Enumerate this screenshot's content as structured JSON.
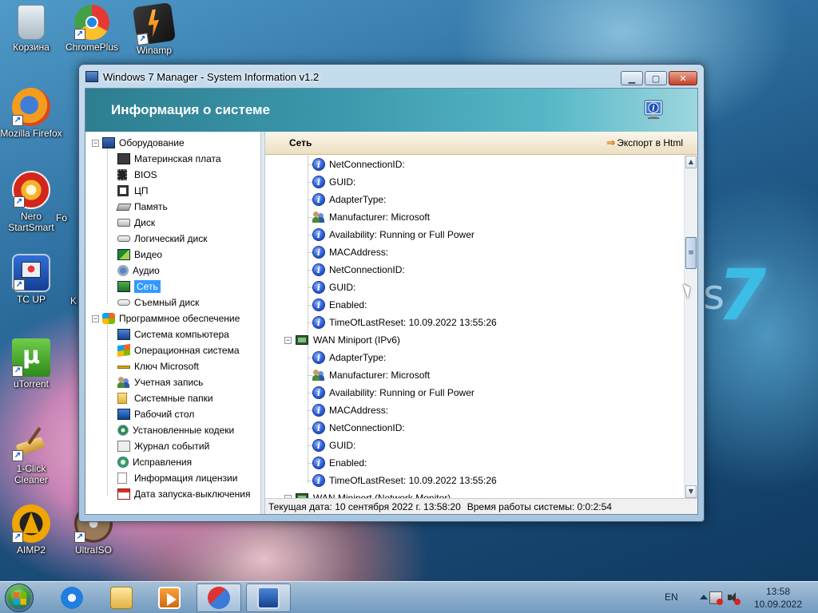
{
  "desktop": {
    "icons": [
      {
        "id": "recycle",
        "label": "Корзина"
      },
      {
        "id": "chromeplus",
        "label": "ChromePlus"
      },
      {
        "id": "winamp",
        "label": "Winamp"
      },
      {
        "id": "firefox",
        "label": "Mozilla Firefox"
      },
      {
        "id": "nero",
        "label": "Nero StartSmart"
      },
      {
        "id": "tcup",
        "label": "TC UP"
      },
      {
        "id": "utorrent",
        "label": "uTorrent"
      },
      {
        "id": "oneclick",
        "label": "1-Click Cleaner"
      },
      {
        "id": "aimp",
        "label": "AIMP2"
      },
      {
        "id": "ultraiso",
        "label": "UltraISO"
      }
    ],
    "partial_labels": [
      "Fo",
      "K"
    ],
    "logo_text": "7",
    "logo_partial": "s"
  },
  "window": {
    "title": "Windows 7 Manager - System Information v1.2",
    "header_title": "Информация о системе",
    "controls": {
      "minimize": "▁",
      "maximize": "▢",
      "close": "✕"
    }
  },
  "tree": {
    "hardware": {
      "label": "Оборудование",
      "items": [
        {
          "label": "Материнская плата",
          "icon": "motherboard-icon"
        },
        {
          "label": "BIOS",
          "icon": "bios-chip-icon"
        },
        {
          "label": "ЦП",
          "icon": "cpu-icon"
        },
        {
          "label": "Память",
          "icon": "memory-icon"
        },
        {
          "label": "Диск",
          "icon": "disk-icon"
        },
        {
          "label": "Логический диск",
          "icon": "logical-disk-icon"
        },
        {
          "label": "Видео",
          "icon": "video-icon"
        },
        {
          "label": "Аудио",
          "icon": "audio-icon"
        },
        {
          "label": "Сеть",
          "icon": "network-icon",
          "selected": true
        },
        {
          "label": "Съемный диск",
          "icon": "removable-disk-icon"
        }
      ]
    },
    "software": {
      "label": "Программное обеспечение",
      "items": [
        {
          "label": "Система компьютера",
          "icon": "computer-system-icon"
        },
        {
          "label": "Операционная система",
          "icon": "windows-flag-icon"
        },
        {
          "label": "Ключ Microsoft",
          "icon": "key-icon"
        },
        {
          "label": "Учетная запись",
          "icon": "users-icon"
        },
        {
          "label": "Системные папки",
          "icon": "folder-icon"
        },
        {
          "label": "Рабочий стол",
          "icon": "desktop-icon"
        },
        {
          "label": "Установленные кодеки",
          "icon": "codecs-icon"
        },
        {
          "label": "Журнал событий",
          "icon": "event-log-icon"
        },
        {
          "label": "Исправления",
          "icon": "hotfix-icon"
        },
        {
          "label": "Информация лицензии",
          "icon": "license-icon"
        },
        {
          "label": "Дата запуска-выключения",
          "icon": "calendar-icon"
        }
      ]
    }
  },
  "panel": {
    "section_title": "Сеть",
    "export_label": "Экспорт в Html",
    "rows": [
      {
        "type": "prop",
        "icon": "info",
        "text": "NetConnectionID:"
      },
      {
        "type": "prop",
        "icon": "info",
        "text": "GUID:"
      },
      {
        "type": "prop",
        "icon": "info",
        "text": "AdapterType:"
      },
      {
        "type": "prop",
        "icon": "people",
        "text": "Manufacturer: Microsoft"
      },
      {
        "type": "prop",
        "icon": "info",
        "text": "Availability: Running or Full Power"
      },
      {
        "type": "prop",
        "icon": "info",
        "text": "MACAddress:"
      },
      {
        "type": "prop",
        "icon": "info",
        "text": "NetConnectionID:"
      },
      {
        "type": "prop",
        "icon": "info",
        "text": "GUID:"
      },
      {
        "type": "prop",
        "icon": "info",
        "text": "Enabled:"
      },
      {
        "type": "prop",
        "icon": "info",
        "text": "TimeOfLastReset: 10.09.2022 13:55:26"
      },
      {
        "type": "group",
        "text": "WAN Miniport (IPv6)"
      },
      {
        "type": "prop",
        "icon": "info",
        "text": "AdapterType:"
      },
      {
        "type": "prop",
        "icon": "people",
        "text": "Manufacturer: Microsoft"
      },
      {
        "type": "prop",
        "icon": "info",
        "text": "Availability: Running or Full Power"
      },
      {
        "type": "prop",
        "icon": "info",
        "text": "MACAddress:"
      },
      {
        "type": "prop",
        "icon": "info",
        "text": "NetConnectionID:"
      },
      {
        "type": "prop",
        "icon": "info",
        "text": "GUID:"
      },
      {
        "type": "prop",
        "icon": "info",
        "text": "Enabled:"
      },
      {
        "type": "prop",
        "icon": "info",
        "text": "TimeOfLastReset: 10.09.2022 13:55:26"
      },
      {
        "type": "group",
        "text": "WAN Miniport (Network Monitor)"
      }
    ]
  },
  "status": {
    "current_date": "Текущая дата: 10 сентября 2022 г.  13:58:20",
    "uptime": "Время работы системы: 0:0:2:54"
  },
  "taskbar": {
    "language": "EN",
    "time": "13:58",
    "date": "10.09.2022"
  }
}
